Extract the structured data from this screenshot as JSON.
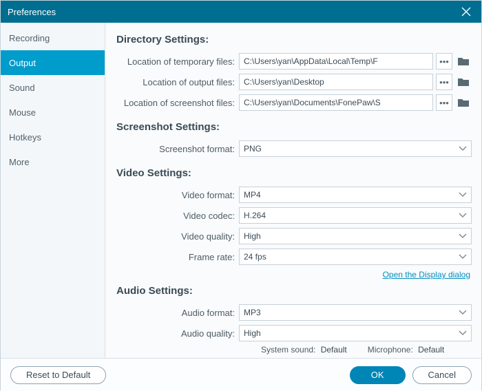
{
  "window": {
    "title": "Preferences"
  },
  "sidebar": {
    "items": [
      {
        "label": "Recording"
      },
      {
        "label": "Output"
      },
      {
        "label": "Sound"
      },
      {
        "label": "Mouse"
      },
      {
        "label": "Hotkeys"
      },
      {
        "label": "More"
      }
    ],
    "selected": "Output"
  },
  "sections": {
    "directory": {
      "title": "Directory Settings:",
      "items": {
        "temp": {
          "label": "Location of temporary files:",
          "value": "C:\\Users\\yan\\AppData\\Local\\Temp\\F"
        },
        "output": {
          "label": "Location of output files:",
          "value": "C:\\Users\\yan\\Desktop"
        },
        "screenshot": {
          "label": "Location of screenshot files:",
          "value": "C:\\Users\\yan\\Documents\\FonePaw\\S"
        }
      }
    },
    "screenshot": {
      "title": "Screenshot Settings:",
      "format": {
        "label": "Screenshot format:",
        "value": "PNG"
      }
    },
    "video": {
      "title": "Video Settings:",
      "format": {
        "label": "Video format:",
        "value": "MP4"
      },
      "codec": {
        "label": "Video codec:",
        "value": "H.264"
      },
      "quality": {
        "label": "Video quality:",
        "value": "High"
      },
      "fps": {
        "label": "Frame rate:",
        "value": "24 fps"
      },
      "link": "Open the Display dialog"
    },
    "audio": {
      "title": "Audio Settings:",
      "format": {
        "label": "Audio format:",
        "value": "MP3"
      },
      "quality": {
        "label": "Audio quality:",
        "value": "High"
      },
      "system": {
        "label": "System sound:",
        "value": "Default"
      },
      "mic": {
        "label": "Microphone:",
        "value": "Default"
      }
    }
  },
  "footer": {
    "reset": "Reset to Default",
    "ok": "OK",
    "cancel": "Cancel"
  }
}
